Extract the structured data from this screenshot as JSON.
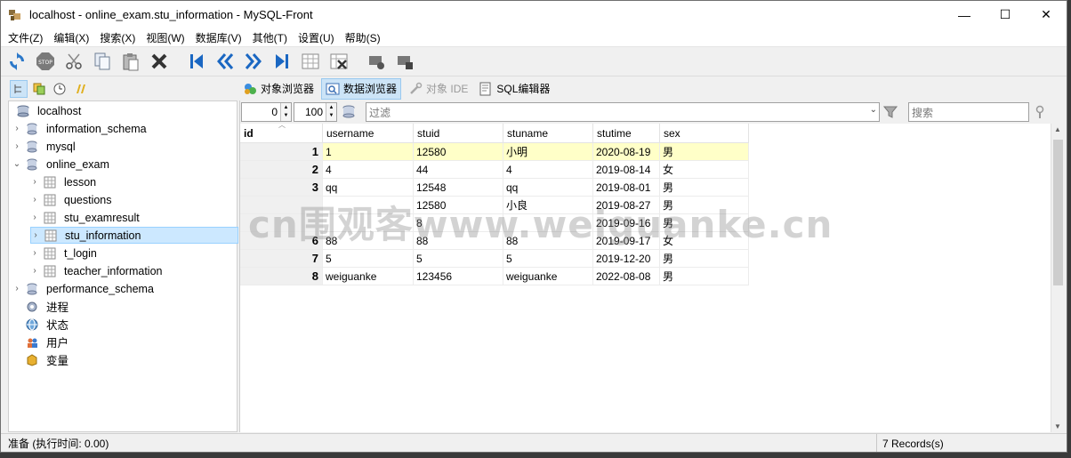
{
  "window": {
    "title": "localhost - online_exam.stu_information - MySQL-Front",
    "controls": {
      "minimize": "—",
      "maximize": "☐",
      "close": "✕"
    }
  },
  "menu": [
    "文件(Z)",
    "编辑(X)",
    "搜索(X)",
    "视图(W)",
    "数据库(V)",
    "其他(T)",
    "设置(U)",
    "帮助(S)"
  ],
  "tabs": {
    "object_browser": "对象浏览器",
    "data_browser": "数据浏览器",
    "object_ide": "对象 IDE",
    "sql_editor": "SQL编辑器"
  },
  "filter": {
    "offset": "0",
    "limit": "100",
    "filter_placeholder": "过滤",
    "search_placeholder": "搜索"
  },
  "tree": {
    "root": "localhost",
    "items": [
      {
        "label": "information_schema",
        "level": 1,
        "expander": "›",
        "icon": "database-icon"
      },
      {
        "label": "mysql",
        "level": 1,
        "expander": "›",
        "icon": "database-icon"
      },
      {
        "label": "online_exam",
        "level": 1,
        "expander": "⌄",
        "icon": "database-icon"
      },
      {
        "label": "lesson",
        "level": 2,
        "expander": "›",
        "icon": "table-icon"
      },
      {
        "label": "questions",
        "level": 2,
        "expander": "›",
        "icon": "table-icon"
      },
      {
        "label": "stu_examresult",
        "level": 2,
        "expander": "›",
        "icon": "table-icon"
      },
      {
        "label": "stu_information",
        "level": 2,
        "expander": "›",
        "icon": "table-icon",
        "selected": true
      },
      {
        "label": "t_login",
        "level": 2,
        "expander": "›",
        "icon": "table-icon"
      },
      {
        "label": "teacher_information",
        "level": 2,
        "expander": "›",
        "icon": "table-icon"
      },
      {
        "label": "performance_schema",
        "level": 1,
        "expander": "›",
        "icon": "database-icon"
      },
      {
        "label": "进程",
        "level": 1,
        "expander": "",
        "icon": "process-icon"
      },
      {
        "label": "状态",
        "level": 1,
        "expander": "",
        "icon": "status-icon"
      },
      {
        "label": "用户",
        "level": 1,
        "expander": "",
        "icon": "users-icon"
      },
      {
        "label": "变量",
        "level": 1,
        "expander": "",
        "icon": "variables-icon"
      }
    ]
  },
  "grid": {
    "columns": [
      "id",
      "username",
      "stuid",
      "stuname",
      "stutime",
      "sex"
    ],
    "rows": [
      [
        "1",
        "1",
        "12580",
        "小明",
        "2020-08-19",
        "男"
      ],
      [
        "2",
        "4",
        "44",
        "4",
        "2019-08-14",
        "女"
      ],
      [
        "3",
        "qq",
        "12548",
        "qq",
        "2019-08-01",
        "男"
      ],
      [
        "",
        "",
        "12580",
        "小良",
        "2019-08-27",
        "男"
      ],
      [
        "",
        "",
        "8",
        "",
        "2019-09-16",
        "男"
      ],
      [
        "6",
        "88",
        "88",
        "88",
        "2019-09-17",
        "女"
      ],
      [
        "7",
        "5",
        "5",
        "5",
        "2019-12-20",
        "男"
      ],
      [
        "8",
        "weiguanke",
        "123456",
        "weiguanke",
        "2022-08-08",
        "男"
      ]
    ]
  },
  "status": {
    "left": "准备  (执行时间: 0.00)",
    "right": "7 Records(s)"
  },
  "watermark": "cn围观客www.weiguanke.cn"
}
